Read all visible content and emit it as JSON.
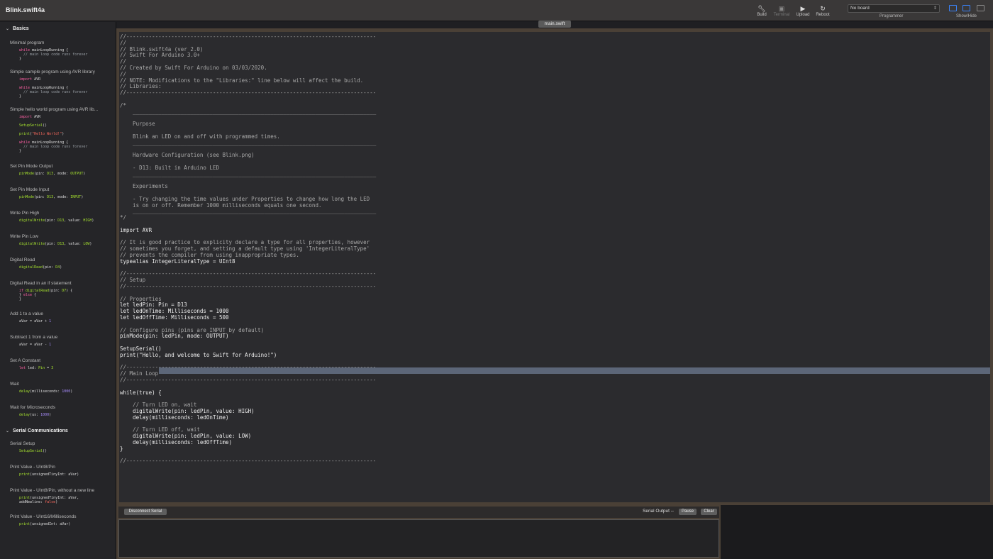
{
  "app": {
    "title": "Blink.swift4a"
  },
  "toolbar": {
    "build": "Build",
    "terminal": "Terminal",
    "upload": "Upload",
    "reboot": "Reboot",
    "board": "No board",
    "programmer": "Programmer",
    "showhide": "Show/Hide"
  },
  "sidebar": {
    "basics": "Basics",
    "s1": "Minimal program",
    "s2": "Simple sample program using AVR library",
    "s3": "Simple hello world program using AVR lib...",
    "s4": "Set Pin Mode Output",
    "s5": "Set Pin Mode Input",
    "s6": "Write Pin High",
    "s7": "Write Pin Low",
    "s8": "Digital Read",
    "s9": "Digital Read in an if statement",
    "s10": "Add 1 to a value",
    "s11": "Subtract 1 from a value",
    "s12": "Set A Constant",
    "s13": "Wait",
    "s14": "Wait for Microseconds",
    "serial": "Serial Communications",
    "s15": "Serial Setup",
    "s16": "Print Value - UInt8/Pin",
    "s17": "Print Value - UInt8/Pin, without a new line",
    "s18": "Print Value - UInt16/Milliseconds"
  },
  "editor": {
    "tab": "main.swift",
    "lines": [
      "//------------------------------------------------------------------------------",
      "//",
      "// Blink.swift4a (ver 2.0)",
      "// Swift For Arduino 3.0+",
      "//",
      "// Created by Swift For Arduino on 03/03/2020.",
      "//",
      "// NOTE: Modifications to the \"Libraries:\" line below will affect the build.",
      "// Libraries:",
      "//------------------------------------------------------------------------------",
      "",
      "/*",
      "    ____________________________________________________________________________",
      "",
      "    Purpose",
      "",
      "    Blink an LED on and off with programmed times.",
      "    ____________________________________________________________________________",
      "",
      "    Hardware Configuration (see Blink.png)",
      "",
      "    - D13: Built in Arduino LED",
      "    ____________________________________________________________________________",
      "",
      "    Experiments",
      "",
      "    - Try changing the time values under Properties to change how long the LED",
      "    is on or off. Remember 1000 milliseconds equals one second.",
      "    ____________________________________________________________________________",
      "*/",
      "",
      "import AVR",
      "",
      "// It is good practice to explicity declare a type for all properties, however",
      "// sometimes you forget, and setting a default type using 'IntegerLiteralType'",
      "// prevents the compiler from using inappropriate types.",
      "typealias IntegerLiteralType = UInt8",
      "",
      "//------------------------------------------------------------------------------",
      "// Setup",
      "//------------------------------------------------------------------------------",
      "",
      "// Properties",
      "let ledPin: Pin = D13",
      "let ledOnTime: Milliseconds = 1000",
      "let ledOffTime: Milliseconds = 500",
      "",
      "// Configure pins (pins are INPUT by default)",
      "pinMode(pin: ledPin, mode: OUTPUT)",
      "",
      "SetupSerial()",
      "print(\"Hello, and welcome to Swift for Arduino!\")",
      "",
      "//------------------------------------------------------------------------------",
      "// Main Loop",
      "//------------------------------------------------------------------------------",
      "",
      "while(true) {",
      "",
      "    // Turn LED on, wait",
      "    digitalWrite(pin: ledPin, value: HIGH)",
      "    delay(milliseconds: ledOnTime)",
      "",
      "    // Turn LED off, wait",
      "    digitalWrite(pin: ledPin, value: LOW)",
      "    delay(milliseconds: ledOffTime)",
      "}",
      "",
      "//------------------------------------------------------------------------------"
    ]
  },
  "serial": {
    "disconnect": "Disconnect Serial",
    "output": "Serial Output --",
    "pause": "Pause",
    "clear": "Clear"
  }
}
